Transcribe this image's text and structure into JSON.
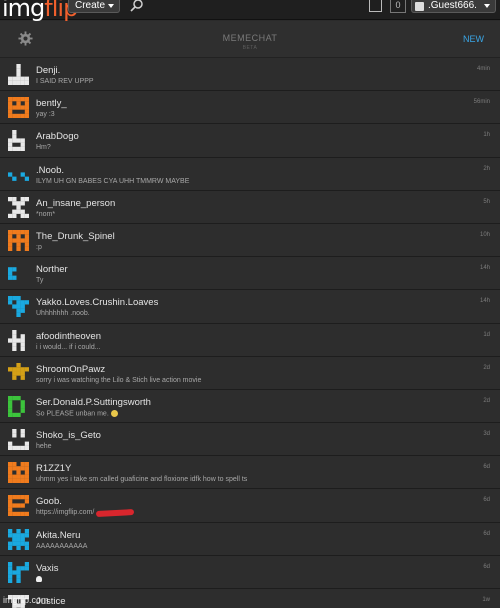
{
  "topbar": {
    "logo_a": "img",
    "logo_b": "flip",
    "create_label": "Create",
    "notif_count": "0",
    "user_label": ".Guest666."
  },
  "header": {
    "title": "MEMECHAT",
    "subtitle": "BETA",
    "new_label": "NEW"
  },
  "chats": [
    {
      "name": "Denji.",
      "preview": "I SAID REV UPPP",
      "time": "4min",
      "avatar_color": "#e8e8e8"
    },
    {
      "name": "bently_",
      "preview": "yay :3",
      "time": "56min",
      "avatar_color": "#f07b1d"
    },
    {
      "name": "ArabDogo",
      "preview": "Hm?",
      "time": "1h",
      "avatar_color": "#e8e8e8"
    },
    {
      "name": ".Noob.",
      "preview": "ILYM UH GN BABES CYA UHH TMMRW MAYBE",
      "time": "2h",
      "avatar_color": "#1aa9e0"
    },
    {
      "name": "An_insane_person",
      "preview": "*nom*",
      "time": "5h",
      "avatar_color": "#e8e8e8"
    },
    {
      "name": "The_Drunk_Spinel",
      "preview": ":p",
      "time": "10h",
      "avatar_color": "#f07b1d"
    },
    {
      "name": "Norther",
      "preview": "Ty",
      "time": "14h",
      "avatar_color": "#1aa9e0"
    },
    {
      "name": "Yakko.Loves.Crushin.Loaves",
      "preview": "Uhhhhhhh .noob.",
      "time": "14h",
      "avatar_color": "#1aa9e0"
    },
    {
      "name": "afoodintheoven",
      "preview": "i i would... if i could...",
      "time": "1d",
      "avatar_color": "#e8e8e8"
    },
    {
      "name": "ShroomOnPawz",
      "preview": "sorry i was watching the Lilo & Stich live action movie",
      "time": "2d",
      "avatar_color": "#d4a017"
    },
    {
      "name": "Ser.Donald.P.Suttingsworth",
      "preview": "So PLEASE unban me.",
      "time": "2d",
      "avatar_color": "#3cc43c"
    },
    {
      "name": "Shoko_is_Geto",
      "preview": "hehe",
      "time": "3d",
      "avatar_color": "#e8e8e8"
    },
    {
      "name": "R1ZZ1Y",
      "preview": "uhmm yes i take sm called guaficine and floxione idfk how to spell ts",
      "time": "6d",
      "avatar_color": "#f07b1d"
    },
    {
      "name": "Goob.",
      "preview": "https://imgflip.com/",
      "time": "6d",
      "avatar_color": "#f07b1d"
    },
    {
      "name": "Akita.Neru",
      "preview": "AAAAAAAAAAA",
      "time": "6d",
      "avatar_color": "#1aa9e0"
    },
    {
      "name": "Vaxis",
      "preview": "",
      "time": "6d",
      "avatar_color": "#1aa9e0"
    },
    {
      "name": "Justice",
      "preview": "",
      "time": "1w",
      "avatar_color": "#e8e8e8"
    }
  ],
  "watermark": "imgflip.com"
}
